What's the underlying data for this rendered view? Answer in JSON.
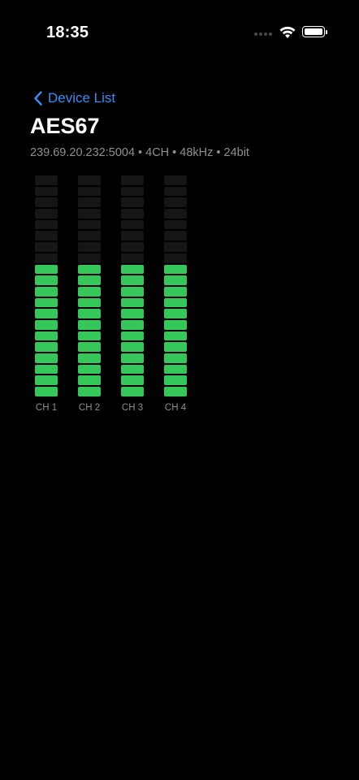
{
  "status_bar": {
    "time": "18:35",
    "icons": [
      "signal-dots-icon",
      "wifi-icon",
      "battery-icon"
    ]
  },
  "nav": {
    "back_label": "Device List",
    "back_icon": "chevron-left-icon"
  },
  "device": {
    "title": "AES67",
    "subtitle": "239.69.20.232:5004 • 4CH • 48kHz • 24bit"
  },
  "meters": {
    "segment_count": 20,
    "colors": {
      "active": "#35c759",
      "inactive": "#161616",
      "accent": "#3a8df6"
    },
    "channels": [
      {
        "label": "CH 1",
        "level": 0.6
      },
      {
        "label": "CH 2",
        "level": 0.6
      },
      {
        "label": "CH 3",
        "level": 0.6
      },
      {
        "label": "CH 4",
        "level": 0.6
      }
    ]
  }
}
